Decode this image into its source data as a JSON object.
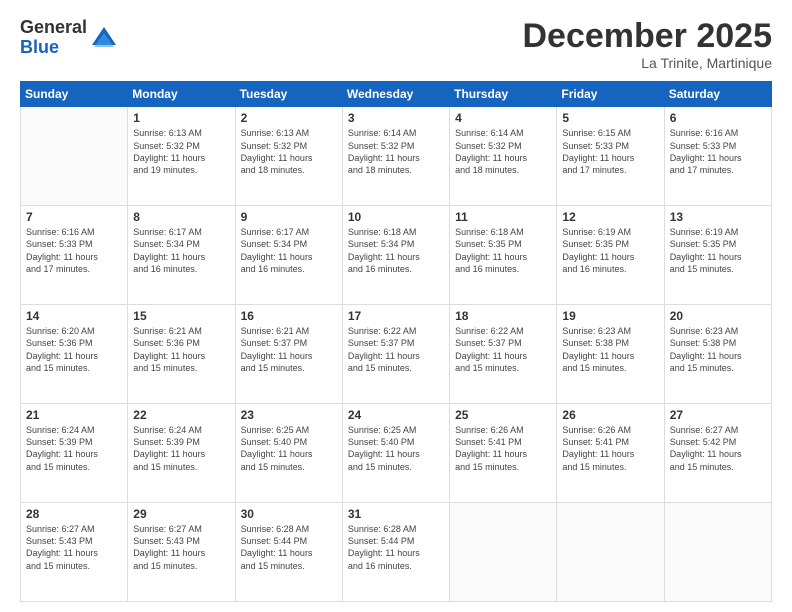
{
  "logo": {
    "general": "General",
    "blue": "Blue"
  },
  "header": {
    "month": "December 2025",
    "location": "La Trinite, Martinique"
  },
  "weekdays": [
    "Sunday",
    "Monday",
    "Tuesday",
    "Wednesday",
    "Thursday",
    "Friday",
    "Saturday"
  ],
  "weeks": [
    [
      {
        "day": "",
        "info": ""
      },
      {
        "day": "1",
        "info": "Sunrise: 6:13 AM\nSunset: 5:32 PM\nDaylight: 11 hours\nand 19 minutes."
      },
      {
        "day": "2",
        "info": "Sunrise: 6:13 AM\nSunset: 5:32 PM\nDaylight: 11 hours\nand 18 minutes."
      },
      {
        "day": "3",
        "info": "Sunrise: 6:14 AM\nSunset: 5:32 PM\nDaylight: 11 hours\nand 18 minutes."
      },
      {
        "day": "4",
        "info": "Sunrise: 6:14 AM\nSunset: 5:32 PM\nDaylight: 11 hours\nand 18 minutes."
      },
      {
        "day": "5",
        "info": "Sunrise: 6:15 AM\nSunset: 5:33 PM\nDaylight: 11 hours\nand 17 minutes."
      },
      {
        "day": "6",
        "info": "Sunrise: 6:16 AM\nSunset: 5:33 PM\nDaylight: 11 hours\nand 17 minutes."
      }
    ],
    [
      {
        "day": "7",
        "info": "Sunrise: 6:16 AM\nSunset: 5:33 PM\nDaylight: 11 hours\nand 17 minutes."
      },
      {
        "day": "8",
        "info": "Sunrise: 6:17 AM\nSunset: 5:34 PM\nDaylight: 11 hours\nand 16 minutes."
      },
      {
        "day": "9",
        "info": "Sunrise: 6:17 AM\nSunset: 5:34 PM\nDaylight: 11 hours\nand 16 minutes."
      },
      {
        "day": "10",
        "info": "Sunrise: 6:18 AM\nSunset: 5:34 PM\nDaylight: 11 hours\nand 16 minutes."
      },
      {
        "day": "11",
        "info": "Sunrise: 6:18 AM\nSunset: 5:35 PM\nDaylight: 11 hours\nand 16 minutes."
      },
      {
        "day": "12",
        "info": "Sunrise: 6:19 AM\nSunset: 5:35 PM\nDaylight: 11 hours\nand 16 minutes."
      },
      {
        "day": "13",
        "info": "Sunrise: 6:19 AM\nSunset: 5:35 PM\nDaylight: 11 hours\nand 15 minutes."
      }
    ],
    [
      {
        "day": "14",
        "info": "Sunrise: 6:20 AM\nSunset: 5:36 PM\nDaylight: 11 hours\nand 15 minutes."
      },
      {
        "day": "15",
        "info": "Sunrise: 6:21 AM\nSunset: 5:36 PM\nDaylight: 11 hours\nand 15 minutes."
      },
      {
        "day": "16",
        "info": "Sunrise: 6:21 AM\nSunset: 5:37 PM\nDaylight: 11 hours\nand 15 minutes."
      },
      {
        "day": "17",
        "info": "Sunrise: 6:22 AM\nSunset: 5:37 PM\nDaylight: 11 hours\nand 15 minutes."
      },
      {
        "day": "18",
        "info": "Sunrise: 6:22 AM\nSunset: 5:37 PM\nDaylight: 11 hours\nand 15 minutes."
      },
      {
        "day": "19",
        "info": "Sunrise: 6:23 AM\nSunset: 5:38 PM\nDaylight: 11 hours\nand 15 minutes."
      },
      {
        "day": "20",
        "info": "Sunrise: 6:23 AM\nSunset: 5:38 PM\nDaylight: 11 hours\nand 15 minutes."
      }
    ],
    [
      {
        "day": "21",
        "info": "Sunrise: 6:24 AM\nSunset: 5:39 PM\nDaylight: 11 hours\nand 15 minutes."
      },
      {
        "day": "22",
        "info": "Sunrise: 6:24 AM\nSunset: 5:39 PM\nDaylight: 11 hours\nand 15 minutes."
      },
      {
        "day": "23",
        "info": "Sunrise: 6:25 AM\nSunset: 5:40 PM\nDaylight: 11 hours\nand 15 minutes."
      },
      {
        "day": "24",
        "info": "Sunrise: 6:25 AM\nSunset: 5:40 PM\nDaylight: 11 hours\nand 15 minutes."
      },
      {
        "day": "25",
        "info": "Sunrise: 6:26 AM\nSunset: 5:41 PM\nDaylight: 11 hours\nand 15 minutes."
      },
      {
        "day": "26",
        "info": "Sunrise: 6:26 AM\nSunset: 5:41 PM\nDaylight: 11 hours\nand 15 minutes."
      },
      {
        "day": "27",
        "info": "Sunrise: 6:27 AM\nSunset: 5:42 PM\nDaylight: 11 hours\nand 15 minutes."
      }
    ],
    [
      {
        "day": "28",
        "info": "Sunrise: 6:27 AM\nSunset: 5:43 PM\nDaylight: 11 hours\nand 15 minutes."
      },
      {
        "day": "29",
        "info": "Sunrise: 6:27 AM\nSunset: 5:43 PM\nDaylight: 11 hours\nand 15 minutes."
      },
      {
        "day": "30",
        "info": "Sunrise: 6:28 AM\nSunset: 5:44 PM\nDaylight: 11 hours\nand 15 minutes."
      },
      {
        "day": "31",
        "info": "Sunrise: 6:28 AM\nSunset: 5:44 PM\nDaylight: 11 hours\nand 16 minutes."
      },
      {
        "day": "",
        "info": ""
      },
      {
        "day": "",
        "info": ""
      },
      {
        "day": "",
        "info": ""
      }
    ]
  ]
}
